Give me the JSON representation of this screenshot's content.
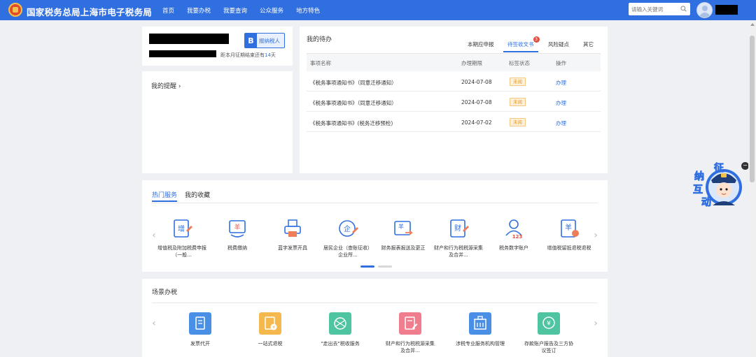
{
  "header": {
    "site_title": "国家税务总局上海市电子税务局",
    "nav": [
      "首页",
      "我要办税",
      "我要查询",
      "公众服务",
      "地方特色"
    ],
    "search_placeholder": "请输入关键词"
  },
  "user_card": {
    "badge_letter": "B",
    "badge_text": "报纳税人",
    "deadline_prefix": "距本月征期结束还有",
    "deadline_days": "14",
    "deadline_suffix": "天"
  },
  "reminder": {
    "title": "我的提醒 ›"
  },
  "todo": {
    "title": "我的待办",
    "tabs": [
      "本期应申报",
      "待签收文书",
      "风险疑点",
      "其它"
    ],
    "active_tab": "待签收文书",
    "tab_badge": "3",
    "columns": [
      "事项名称",
      "办理期限",
      "标签状态",
      "操作"
    ],
    "rows": [
      {
        "name": "《税务事项通知书》（同意迁移通知）",
        "date": "2024-07-08",
        "status": "未阅",
        "action": "办理"
      },
      {
        "name": "《税务事项通知书》（同意迁移通知）",
        "date": "2024-07-08",
        "status": "未阅",
        "action": "办理"
      },
      {
        "name": "《税务事项通知书》(税务迁移预检)",
        "date": "2024-07-02",
        "status": "未阅",
        "action": "办理"
      }
    ]
  },
  "hot_services": {
    "tabs": [
      "热门服务",
      "我的收藏"
    ],
    "items": [
      {
        "label": "增值税及附加税费申报（一般...",
        "icon": "vat-declare-icon",
        "glyph": "增"
      },
      {
        "label": "税费缴纳",
        "icon": "tax-payment-icon",
        "glyph": "羊"
      },
      {
        "label": "蓝字发票开具",
        "icon": "invoice-print-icon",
        "glyph": ""
      },
      {
        "label": "居民企业（查账征收）企业所...",
        "icon": "enterprise-tax-icon",
        "glyph": "企"
      },
      {
        "label": "财务报表报送及更正",
        "icon": "financial-report-icon",
        "glyph": "羊"
      },
      {
        "label": "财产和行为税税源采集及合并...",
        "icon": "property-tax-icon",
        "glyph": "财"
      },
      {
        "label": "税务数字账户",
        "icon": "digital-account-icon",
        "glyph": "123"
      },
      {
        "label": "增值税留抵退税退税",
        "icon": "vat-refund-icon",
        "glyph": "羊"
      }
    ]
  },
  "scenes": {
    "title": "场景办税",
    "items": [
      {
        "label": "发票代开",
        "icon": "invoice-agent-icon",
        "color": "#4a8fe6"
      },
      {
        "label": "一站式退税",
        "icon": "refund-onestop-icon",
        "color": "#f5b84c"
      },
      {
        "label": "\"走出去\"税收服务",
        "icon": "going-global-icon",
        "color": "#4fc4a0"
      },
      {
        "label": "财产和行为税税源采集及合并...",
        "icon": "property-collect-icon",
        "color": "#f07d8e"
      },
      {
        "label": "涉税专业服务机构管理",
        "icon": "agency-manage-icon",
        "color": "#4a8fe6"
      },
      {
        "label": "存款账户报告及三方协议签订",
        "icon": "deposit-account-icon",
        "color": "#4fc4a0"
      }
    ]
  },
  "mascot": {
    "chars": [
      "征",
      "纳",
      "互",
      "动"
    ],
    "close": "−"
  },
  "colors": {
    "primary": "#2f6fdf",
    "tag_bg": "#fdf0dc",
    "tag_text": "#e59a25"
  }
}
